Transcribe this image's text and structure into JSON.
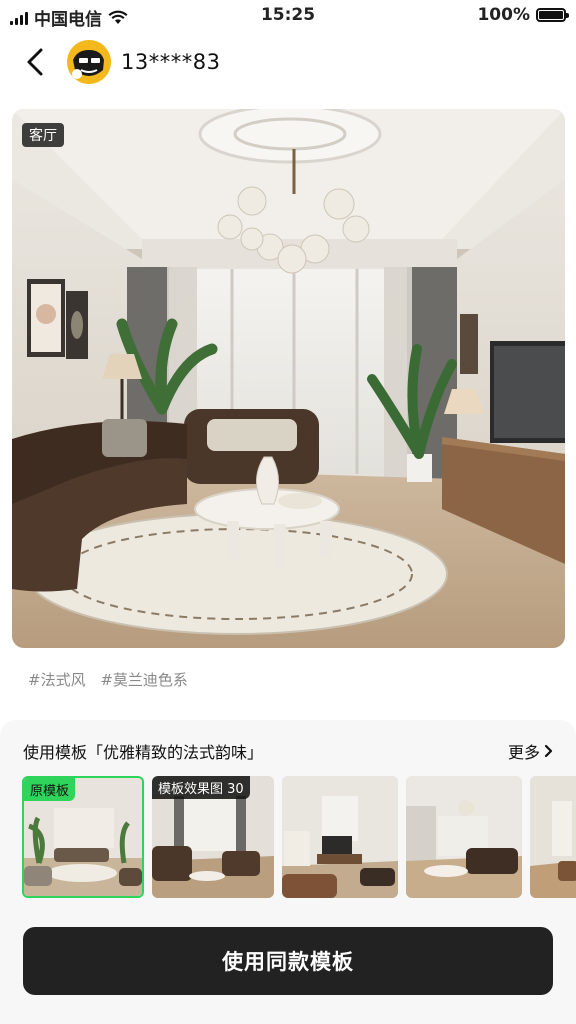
{
  "status_bar": {
    "carrier": "中国电信",
    "time": "15:25",
    "battery_percent": "100%"
  },
  "header": {
    "user_name": "13****83"
  },
  "hero": {
    "room_tag": "客厅"
  },
  "tags": [
    "#法式风",
    "#莫兰迪色系"
  ],
  "template_panel": {
    "title": "使用模板「优雅精致的法式韵味」",
    "more_label": "更多",
    "thumbnails": [
      {
        "label": "原模板",
        "selected": true
      },
      {
        "label": "模板效果图",
        "count": "30"
      },
      {
        "label": ""
      },
      {
        "label": ""
      },
      {
        "label": ""
      }
    ]
  },
  "cta_label": "使用同款模板",
  "colors": {
    "accent_green": "#2fd45a",
    "cta_bg": "#222222",
    "avatar_yellow": "#f3b81c"
  }
}
